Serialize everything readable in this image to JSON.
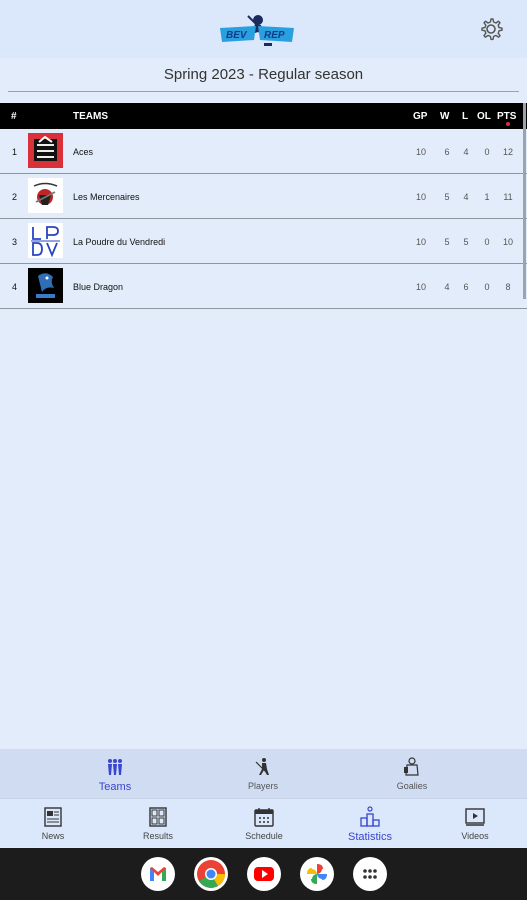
{
  "header": {
    "logo_text": "BEV-REP"
  },
  "season": {
    "title": "Spring 2023 - Regular season"
  },
  "table": {
    "headers": {
      "rank": "#",
      "teams": "TEAMS",
      "gp": "GP",
      "w": "W",
      "l": "L",
      "ol": "OL",
      "pts": "PTS"
    },
    "rows": [
      {
        "rank": "1",
        "team": "Aces",
        "gp": "10",
        "w": "6",
        "l": "4",
        "ol": "0",
        "pts": "12",
        "badge_color": "#d9313a"
      },
      {
        "rank": "2",
        "team": "Les Mercenaires",
        "gp": "10",
        "w": "5",
        "l": "4",
        "ol": "1",
        "pts": "11",
        "badge_color": "#ffffff"
      },
      {
        "rank": "3",
        "team": "La Poudre du Vendredi",
        "gp": "10",
        "w": "5",
        "l": "5",
        "ol": "0",
        "pts": "10",
        "badge_color": "#ffffff"
      },
      {
        "rank": "4",
        "team": "Blue Dragon",
        "gp": "10",
        "w": "4",
        "l": "6",
        "ol": "0",
        "pts": "8",
        "badge_color": "#000000"
      }
    ]
  },
  "subnav": {
    "teams": "Teams",
    "players": "Players",
    "goalies": "Goalies"
  },
  "bottomnav": {
    "news": "News",
    "results": "Results",
    "schedule": "Schedule",
    "statistics": "Statistics",
    "videos": "Videos"
  },
  "colors": {
    "accent": "#3a45d0",
    "header_bg": "#000000",
    "page_bg": "#e3ecfa"
  },
  "dock": {
    "apps": [
      "gmail-icon",
      "chrome-icon",
      "youtube-icon",
      "photos-icon",
      "app-drawer-icon"
    ]
  }
}
